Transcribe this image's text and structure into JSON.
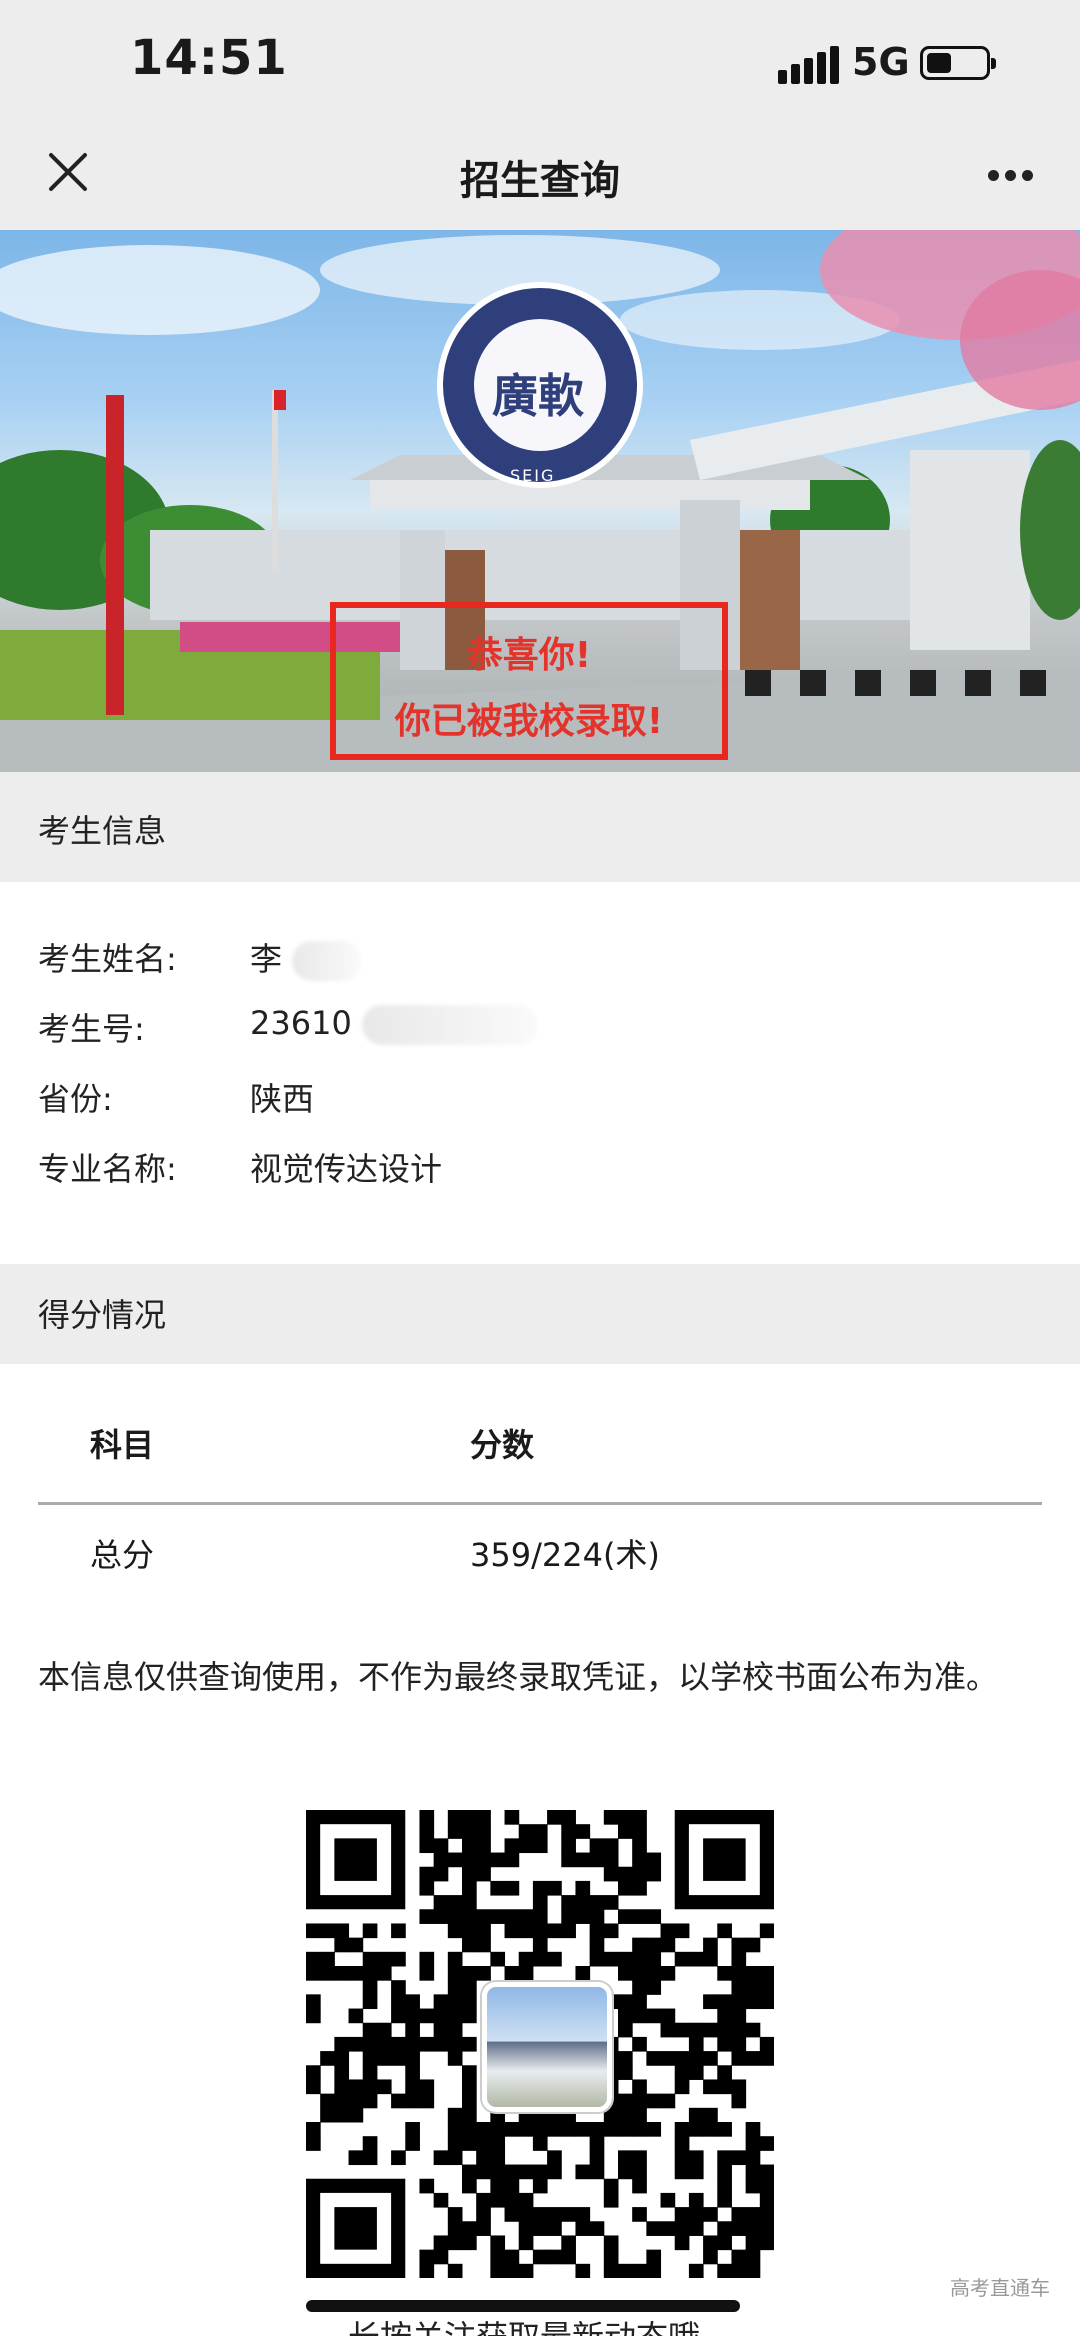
{
  "status_bar": {
    "time": "14:51",
    "network": "5G"
  },
  "nav": {
    "title": "招生查询"
  },
  "hero": {
    "seal_text": "廣軟",
    "seal_ring_text": "SEIG",
    "caption_line1": "恭喜你!",
    "caption_line2": "你已被我校录取!"
  },
  "applicant_section": {
    "title": "考生信息",
    "fields": [
      {
        "label": "考生姓名:",
        "value": "李"
      },
      {
        "label": "考生号:",
        "value": "23610"
      },
      {
        "label": "省份:",
        "value": "陕西"
      },
      {
        "label": "专业名称:",
        "value": "视觉传达设计"
      }
    ]
  },
  "score_section": {
    "title": "得分情况",
    "columns": [
      "科目",
      "分数"
    ],
    "rows": [
      {
        "subject": "总分",
        "score": "359/224(术)"
      }
    ]
  },
  "note": "本信息仅供查询使用，不作为最终录取凭证，以学校书面公布为准。",
  "qr_caption": "长按关注获取最新动态哦",
  "watermark": "高考直通车",
  "colors": {
    "header_bg": "#ededed",
    "caption_red": "#e4332a",
    "border_red": "#e8281f"
  }
}
